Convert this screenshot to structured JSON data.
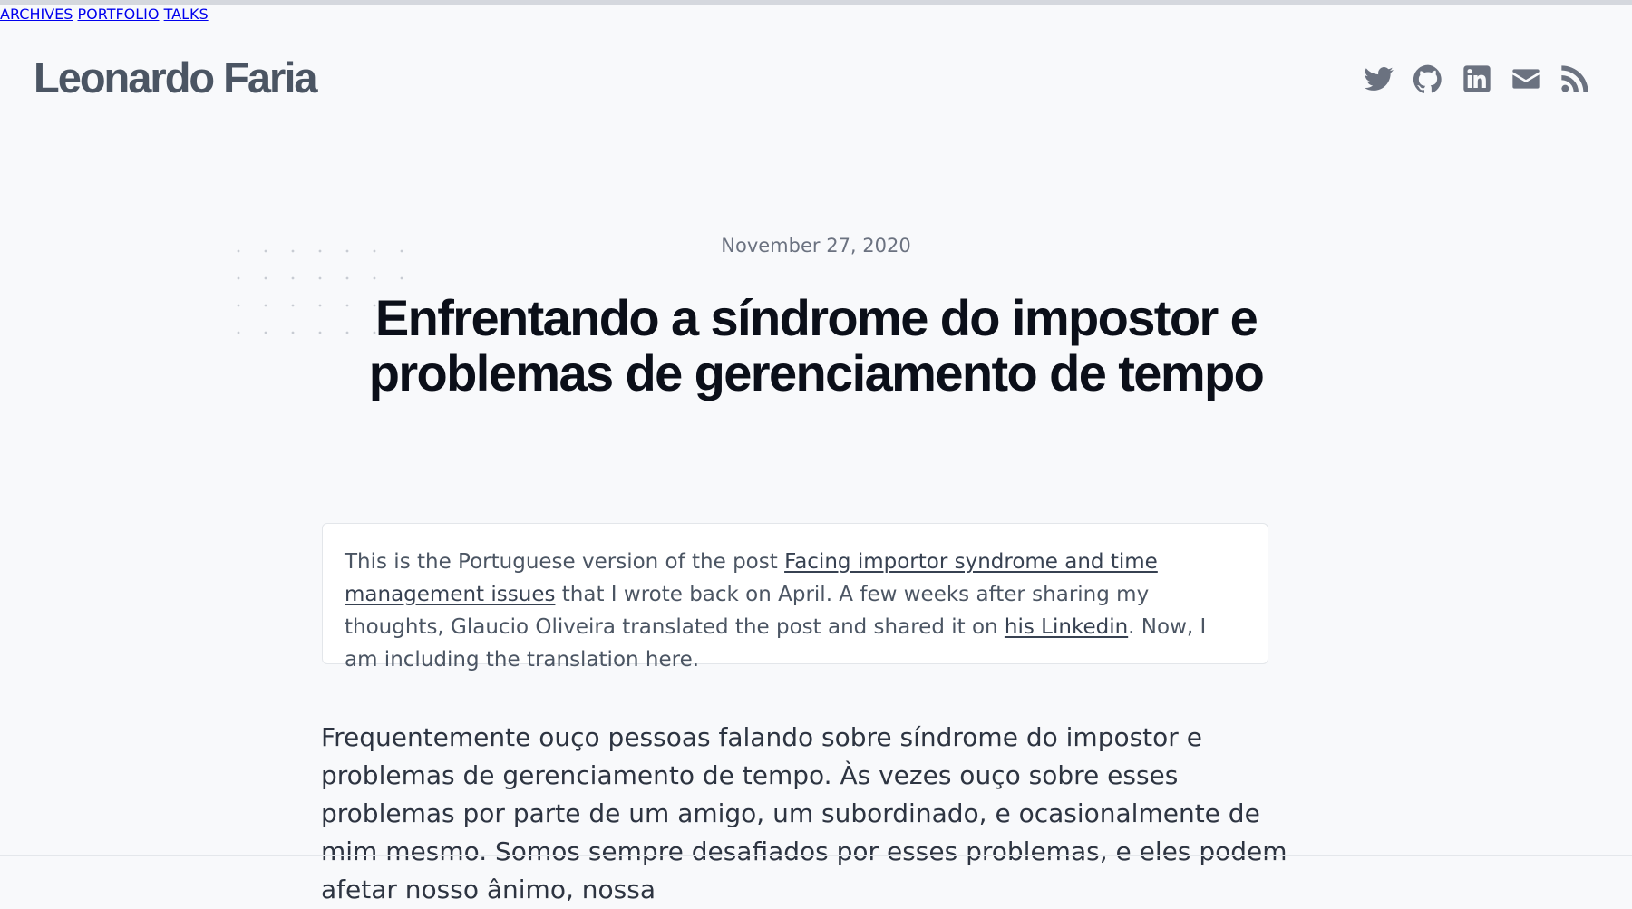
{
  "brand": "Leonardo Faria",
  "nav": [
    {
      "label": "ARCHIVES"
    },
    {
      "label": "PORTFOLIO"
    },
    {
      "label": "TALKS"
    }
  ],
  "social": [
    "twitter-icon",
    "github-icon",
    "linkedin-icon",
    "email-icon",
    "rss-icon"
  ],
  "post": {
    "date": "November 27, 2020",
    "title_line1": "Enfrentando a síndrome do impostor e",
    "title_line2": "problemas de gerenciamento de tempo",
    "note": {
      "text1": "This is the Portuguese version of the post ",
      "link1": "Facing importor syndrome and time management issues",
      "text2": " that I wrote back on April. A few weeks after sharing my thoughts, Glaucio Oliveira translated the post and shared it on ",
      "link2": "his Linkedin",
      "text3": ". Now, I am including the translation here."
    },
    "paragraph": "Frequentemente ouço pessoas falando sobre síndrome do impostor e problemas de gerenciamento de tempo. Às vezes ouço sobre esses problemas por parte de um amigo, um subordinado, e ocasionalmente de mim mesmo. Somos sempre desafiados por esses problemas, e eles podem afetar nosso ânimo, nossa"
  },
  "colors": {
    "background": "#f8f9fb",
    "text": "#374151",
    "muted": "#6b7280",
    "title": "#0b0f19"
  }
}
